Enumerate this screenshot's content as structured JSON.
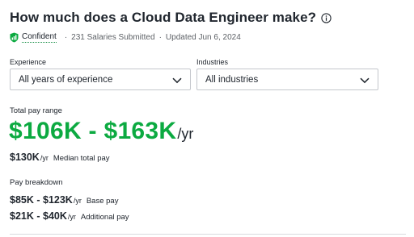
{
  "header": {
    "title": "How much does a Cloud Data Engineer make?"
  },
  "meta": {
    "confidence": "Confident",
    "salaries": "231 Salaries Submitted",
    "updated": "Updated Jun 6, 2024",
    "separator": "·"
  },
  "filters": {
    "experience_label": "Experience",
    "experience_value": "All years of experience",
    "industries_label": "Industries",
    "industries_value": "All industries"
  },
  "total_pay": {
    "label": "Total pay range",
    "range": "$106K - $163K",
    "unit": "/yr",
    "median_value": "$130K",
    "median_unit": "/yr",
    "median_label": "Median total pay"
  },
  "breakdown": {
    "label": "Pay breakdown",
    "base_value": "$85K - $123K",
    "base_unit": "/yr",
    "base_label": "Base pay",
    "additional_value": "$21K - $40K",
    "additional_unit": "/yr",
    "additional_label": "Additional pay"
  },
  "colors": {
    "accent_green": "#0caa41",
    "text": "#20262e",
    "border": "#c4c7cc"
  },
  "icons": {
    "info": "info-icon",
    "shield": "shield-check-icon",
    "chevron": "chevron-down-icon"
  }
}
